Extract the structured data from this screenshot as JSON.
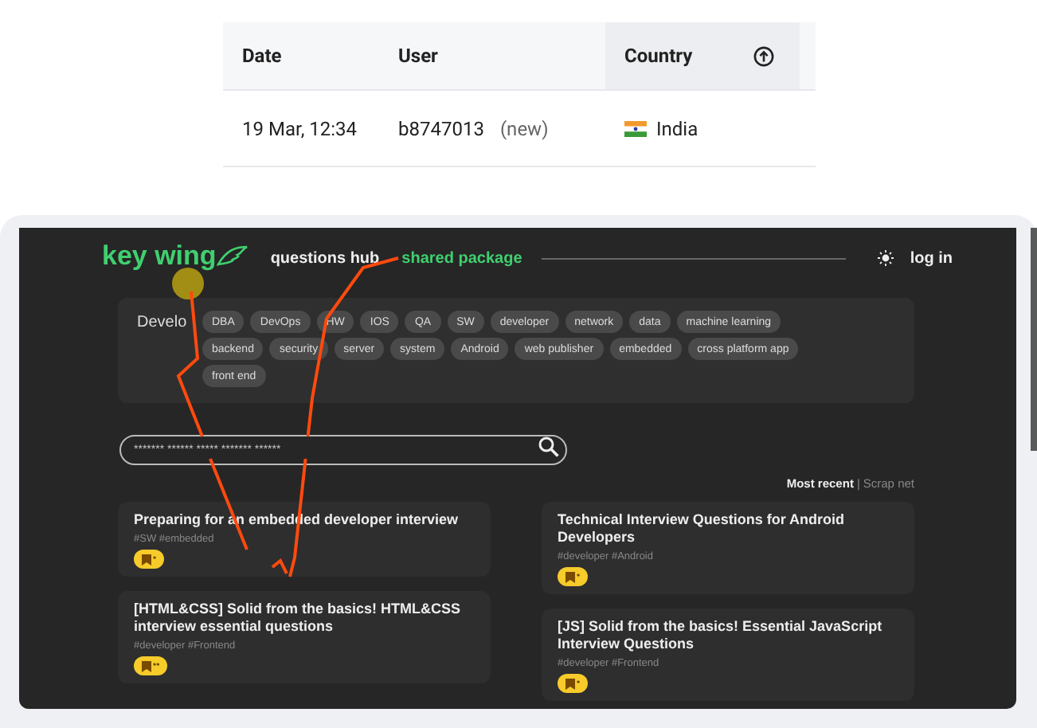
{
  "table": {
    "columns": [
      {
        "label": "Date",
        "sorted": false
      },
      {
        "label": "User",
        "sorted": false
      },
      {
        "label": "Country",
        "sorted": true
      }
    ],
    "rows": [
      {
        "date": "19 Mar, 12:34",
        "user": "b8747013",
        "user_note": "(new)",
        "country": "India"
      }
    ]
  },
  "app": {
    "logo": "key wing",
    "nav": [
      {
        "label": "questions hub",
        "selected": false
      },
      {
        "label": "shared package",
        "selected": true
      }
    ],
    "login": "log in",
    "category_label": "Develo",
    "chips": [
      "DBA",
      "DevOps",
      "HW",
      "IOS",
      "QA",
      "SW",
      "developer",
      "network",
      "data",
      "machine learning",
      "backend",
      "security",
      "server",
      "system",
      "Android",
      "web publisher",
      "embedded",
      "cross platform app",
      "front end"
    ],
    "search": {
      "placeholder": "******* ****** ***** ******* ******"
    },
    "sort_options": [
      {
        "label": "Most recent",
        "selected": true
      },
      {
        "label": "Scrap net",
        "selected": false
      }
    ],
    "sort_separator": "|",
    "card_columns": [
      [
        {
          "title": "Preparing for an embedded developer interview",
          "tags": "#SW #embedded",
          "badge": "•"
        },
        {
          "title": "[HTML&CSS] Solid from the basics! HTML&CSS interview essential questions",
          "tags": "#developer #Frontend",
          "badge": "••"
        }
      ],
      [
        {
          "title": "Technical Interview Questions for Android Developers",
          "tags": "#developer #Android",
          "badge": "•"
        },
        {
          "title": "[JS] Solid from the basics! Essential JavaScript Interview Questions",
          "tags": "#developer #Frontend",
          "badge": "•"
        }
      ]
    ]
  }
}
